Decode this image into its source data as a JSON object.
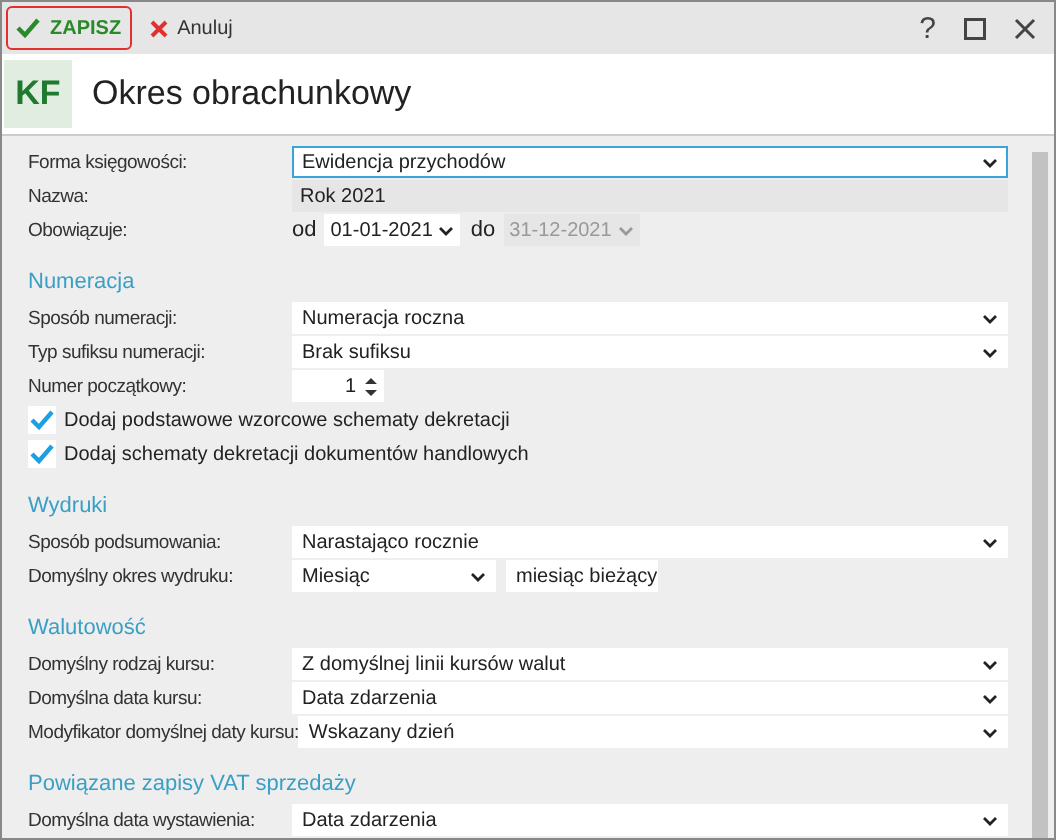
{
  "toolbar": {
    "buttons": [
      {
        "kind": "save",
        "label": "ZAPISZ",
        "selected": true
      },
      {
        "kind": "cancel",
        "label": "Anuluj",
        "selected": false
      }
    ],
    "help": "?"
  },
  "header": {
    "badge": "KF",
    "title": "Okres obrachunkowy"
  },
  "sections": [
    {
      "rows": [
        {
          "kind": "select",
          "label": "Forma księgowości:",
          "value": "Ewidencja przychodów",
          "focused": true
        },
        {
          "kind": "text",
          "label": "Nazwa:",
          "value": "Rok 2021"
        },
        {
          "kind": "range",
          "label": "Obowiązuje:",
          "from_label": "od",
          "from": "01-01-2021",
          "to_label": "do",
          "to": "31-12-2021",
          "to_disabled": true
        }
      ]
    },
    {
      "heading": "Numeracja",
      "rows": [
        {
          "kind": "select",
          "label": "Sposób numeracji:",
          "value": "Numeracja roczna",
          "focused": false
        },
        {
          "kind": "select",
          "label": "Typ sufiksu numeracji:",
          "value": "Brak sufiksu",
          "focused": false
        },
        {
          "kind": "spin",
          "label": "Numer początkowy:",
          "value": "1"
        },
        {
          "kind": "checkbox",
          "label": "Dodaj podstawowe wzorcowe schematy dekretacji",
          "checked": true
        },
        {
          "kind": "checkbox",
          "label": "Dodaj schematy dekretacji dokumentów handlowych",
          "checked": true
        }
      ]
    },
    {
      "heading": "Wydruki",
      "rows": [
        {
          "kind": "select",
          "label": "Sposób podsumowania:",
          "value": "Narastająco rocznie",
          "focused": false
        },
        {
          "kind": "pair",
          "label": "Domyślny okres wydruku:",
          "values": [
            "Miesiąc",
            "miesiąc bieżący"
          ]
        }
      ]
    },
    {
      "heading": "Walutowość",
      "rows": [
        {
          "kind": "select",
          "label": "Domyślny rodzaj kursu:",
          "value": "Z domyślnej linii kursów walut",
          "focused": false
        },
        {
          "kind": "select",
          "label": "Domyślna data kursu:",
          "value": "Data zdarzenia",
          "focused": false
        },
        {
          "kind": "select",
          "label": "Modyfikator domyślnej daty kursu:",
          "value": "Wskazany dzień",
          "focused": false
        }
      ]
    },
    {
      "heading": "Powiązane zapisy VAT sprzedaży",
      "rows": [
        {
          "kind": "select",
          "label": "Domyślna data wystawienia:",
          "value": "Data zdarzenia",
          "focused": false
        }
      ]
    }
  ]
}
